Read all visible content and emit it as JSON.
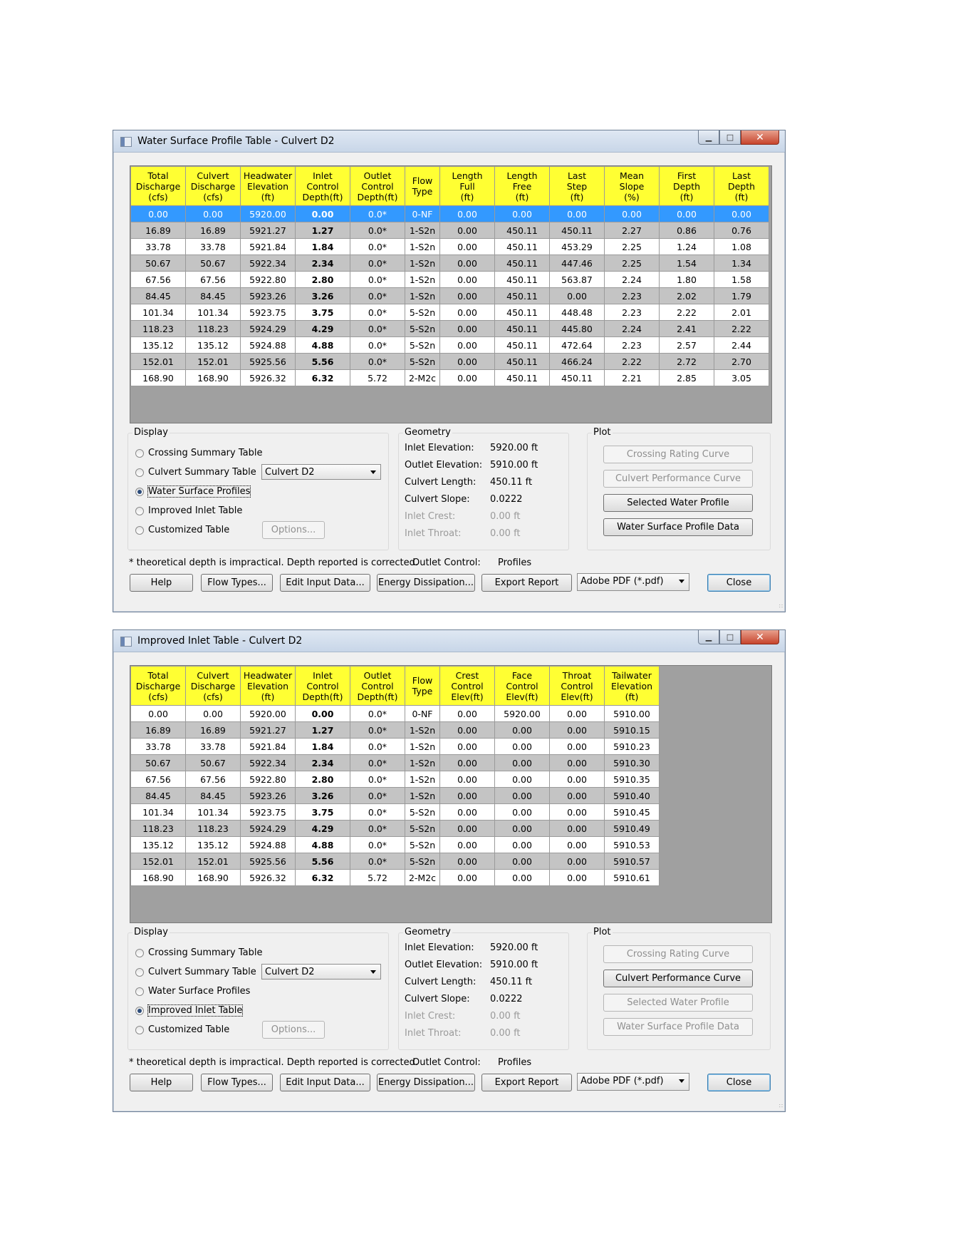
{
  "window1": {
    "title": "Water Surface Profile Table - Culvert D2",
    "columns": [
      [
        "Total",
        "Discharge",
        "(cfs)"
      ],
      [
        "Culvert",
        "Discharge",
        "(cfs)"
      ],
      [
        "Headwater",
        "Elevation",
        "(ft)"
      ],
      [
        "Inlet",
        "Control",
        "Depth(ft)"
      ],
      [
        "Outlet",
        "Control",
        "Depth(ft)"
      ],
      [
        "Flow",
        "Type",
        ""
      ],
      [
        "Length",
        "Full",
        "(ft)"
      ],
      [
        "Length",
        "Free",
        "(ft)"
      ],
      [
        "Last",
        "Step",
        "(ft)"
      ],
      [
        "Mean",
        "Slope",
        "(%)"
      ],
      [
        "First",
        "Depth",
        "(ft)"
      ],
      [
        "Last",
        "Depth",
        "(ft)"
      ]
    ],
    "rows": [
      [
        "0.00",
        "0.00",
        "5920.00",
        "0.00",
        "0.0*",
        "0-NF",
        "0.00",
        "0.00",
        "0.00",
        "0.00",
        "0.00",
        "0.00"
      ],
      [
        "16.89",
        "16.89",
        "5921.27",
        "1.27",
        "0.0*",
        "1-S2n",
        "0.00",
        "450.11",
        "450.11",
        "2.27",
        "0.86",
        "0.76"
      ],
      [
        "33.78",
        "33.78",
        "5921.84",
        "1.84",
        "0.0*",
        "1-S2n",
        "0.00",
        "450.11",
        "453.29",
        "2.25",
        "1.24",
        "1.08"
      ],
      [
        "50.67",
        "50.67",
        "5922.34",
        "2.34",
        "0.0*",
        "1-S2n",
        "0.00",
        "450.11",
        "447.46",
        "2.25",
        "1.54",
        "1.34"
      ],
      [
        "67.56",
        "67.56",
        "5922.80",
        "2.80",
        "0.0*",
        "1-S2n",
        "0.00",
        "450.11",
        "563.87",
        "2.24",
        "1.80",
        "1.58"
      ],
      [
        "84.45",
        "84.45",
        "5923.26",
        "3.26",
        "0.0*",
        "1-S2n",
        "0.00",
        "450.11",
        "0.00",
        "2.23",
        "2.02",
        "1.79"
      ],
      [
        "101.34",
        "101.34",
        "5923.75",
        "3.75",
        "0.0*",
        "5-S2n",
        "0.00",
        "450.11",
        "448.48",
        "2.23",
        "2.22",
        "2.01"
      ],
      [
        "118.23",
        "118.23",
        "5924.29",
        "4.29",
        "0.0*",
        "5-S2n",
        "0.00",
        "450.11",
        "445.80",
        "2.24",
        "2.41",
        "2.22"
      ],
      [
        "135.12",
        "135.12",
        "5924.88",
        "4.88",
        "0.0*",
        "5-S2n",
        "0.00",
        "450.11",
        "472.64",
        "2.23",
        "2.57",
        "2.44"
      ],
      [
        "152.01",
        "152.01",
        "5925.56",
        "5.56",
        "0.0*",
        "5-S2n",
        "0.00",
        "450.11",
        "466.24",
        "2.22",
        "2.72",
        "2.70"
      ],
      [
        "168.90",
        "168.90",
        "5926.32",
        "6.32",
        "5.72",
        "2-M2c",
        "0.00",
        "450.11",
        "450.11",
        "2.21",
        "2.85",
        "3.05"
      ]
    ],
    "selected_display": "Water Surface Profiles",
    "plot_enabled": [
      "Selected Water Profile",
      "Water Surface Profile Data"
    ]
  },
  "window2": {
    "title": "Improved Inlet Table - Culvert D2",
    "columns": [
      [
        "Total",
        "Discharge",
        "(cfs)"
      ],
      [
        "Culvert",
        "Discharge",
        "(cfs)"
      ],
      [
        "Headwater",
        "Elevation",
        "(ft)"
      ],
      [
        "Inlet",
        "Control",
        "Depth(ft)"
      ],
      [
        "Outlet",
        "Control",
        "Depth(ft)"
      ],
      [
        "Flow",
        "Type",
        ""
      ],
      [
        "Crest",
        "Control",
        "Elev(ft)"
      ],
      [
        "Face",
        "Control",
        "Elev(ft)"
      ],
      [
        "Throat",
        "Control",
        "Elev(ft)"
      ],
      [
        "Tailwater",
        "Elevation",
        "(ft)"
      ]
    ],
    "rows": [
      [
        "0.00",
        "0.00",
        "5920.00",
        "0.00",
        "0.0*",
        "0-NF",
        "0.00",
        "5920.00",
        "0.00",
        "5910.00"
      ],
      [
        "16.89",
        "16.89",
        "5921.27",
        "1.27",
        "0.0*",
        "1-S2n",
        "0.00",
        "0.00",
        "0.00",
        "5910.15"
      ],
      [
        "33.78",
        "33.78",
        "5921.84",
        "1.84",
        "0.0*",
        "1-S2n",
        "0.00",
        "0.00",
        "0.00",
        "5910.23"
      ],
      [
        "50.67",
        "50.67",
        "5922.34",
        "2.34",
        "0.0*",
        "1-S2n",
        "0.00",
        "0.00",
        "0.00",
        "5910.30"
      ],
      [
        "67.56",
        "67.56",
        "5922.80",
        "2.80",
        "0.0*",
        "1-S2n",
        "0.00",
        "0.00",
        "0.00",
        "5910.35"
      ],
      [
        "84.45",
        "84.45",
        "5923.26",
        "3.26",
        "0.0*",
        "1-S2n",
        "0.00",
        "0.00",
        "0.00",
        "5910.40"
      ],
      [
        "101.34",
        "101.34",
        "5923.75",
        "3.75",
        "0.0*",
        "5-S2n",
        "0.00",
        "0.00",
        "0.00",
        "5910.45"
      ],
      [
        "118.23",
        "118.23",
        "5924.29",
        "4.29",
        "0.0*",
        "5-S2n",
        "0.00",
        "0.00",
        "0.00",
        "5910.49"
      ],
      [
        "135.12",
        "135.12",
        "5924.88",
        "4.88",
        "0.0*",
        "5-S2n",
        "0.00",
        "0.00",
        "0.00",
        "5910.53"
      ],
      [
        "152.01",
        "152.01",
        "5925.56",
        "5.56",
        "0.0*",
        "5-S2n",
        "0.00",
        "0.00",
        "0.00",
        "5910.57"
      ],
      [
        "168.90",
        "168.90",
        "5926.32",
        "6.32",
        "5.72",
        "2-M2c",
        "0.00",
        "0.00",
        "0.00",
        "5910.61"
      ]
    ],
    "selected_display": "Improved Inlet Table",
    "plot_enabled": [
      "Culvert Performance Curve"
    ]
  },
  "common": {
    "display_label": "Display",
    "display_options": [
      "Crossing Summary Table",
      "Culvert Summary Table",
      "Water Surface Profiles",
      "Improved Inlet Table",
      "Customized Table"
    ],
    "culvert_select": "Culvert D2",
    "options_button": "Options...",
    "geometry_label": "Geometry",
    "geometry": [
      {
        "k": "Inlet Elevation:",
        "v": "5920.00 ft",
        "disabled": false
      },
      {
        "k": "Outlet Elevation:",
        "v": "5910.00 ft",
        "disabled": false
      },
      {
        "k": "Culvert Length:",
        "v": "450.11 ft",
        "disabled": false
      },
      {
        "k": "Culvert Slope:",
        "v": "0.0222",
        "disabled": false
      },
      {
        "k": "Inlet Crest:",
        "v": "0.00 ft",
        "disabled": true
      },
      {
        "k": "Inlet Throat:",
        "v": "0.00 ft",
        "disabled": true
      }
    ],
    "plot_label": "Plot",
    "plot_buttons": [
      "Crossing Rating Curve",
      "Culvert Performance Curve",
      "Selected Water Profile",
      "Water Surface Profile Data"
    ],
    "footnote": "* theoretical depth is impractical.  Depth reported is corrected.",
    "outlet_control_label": "Outlet Control:",
    "outlet_control_value": "Profiles",
    "buttons": [
      "Help",
      "Flow Types...",
      "Edit Input Data...",
      "Energy Dissipation...",
      "Export Report"
    ],
    "format_select": "Adobe PDF (*.pdf)",
    "close": "Close"
  }
}
